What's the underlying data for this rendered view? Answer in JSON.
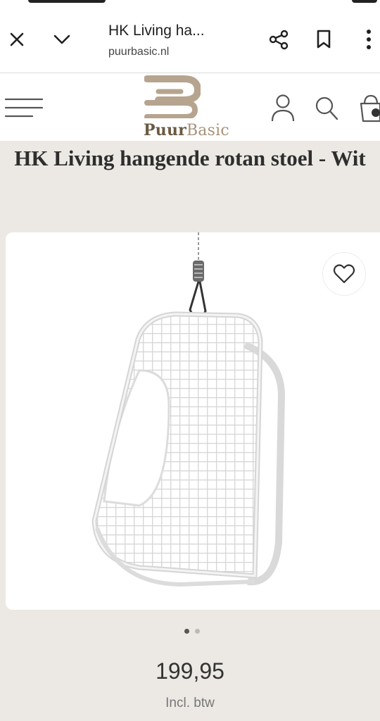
{
  "browser": {
    "title": "HK Living ha...",
    "url": "puurbasic.nl",
    "icons": [
      "close-icon",
      "chevron-down-icon",
      "share-icon",
      "bookmark-icon",
      "more-vertical-icon"
    ]
  },
  "site": {
    "brand_part1": "Puur",
    "brand_part2": "Basic",
    "icons": [
      "menu-icon",
      "user-icon",
      "search-icon",
      "cart-icon"
    ],
    "brand_colors": {
      "logo": "#b6a48f",
      "text_dark": "#6b5a43",
      "text_light": "#a8927a"
    }
  },
  "product": {
    "title": "HK Living hangende rotan stoel - Wit",
    "image_dots": {
      "count": 2,
      "active": 1
    },
    "price": "199,95",
    "vat_note": "Incl. btw"
  }
}
